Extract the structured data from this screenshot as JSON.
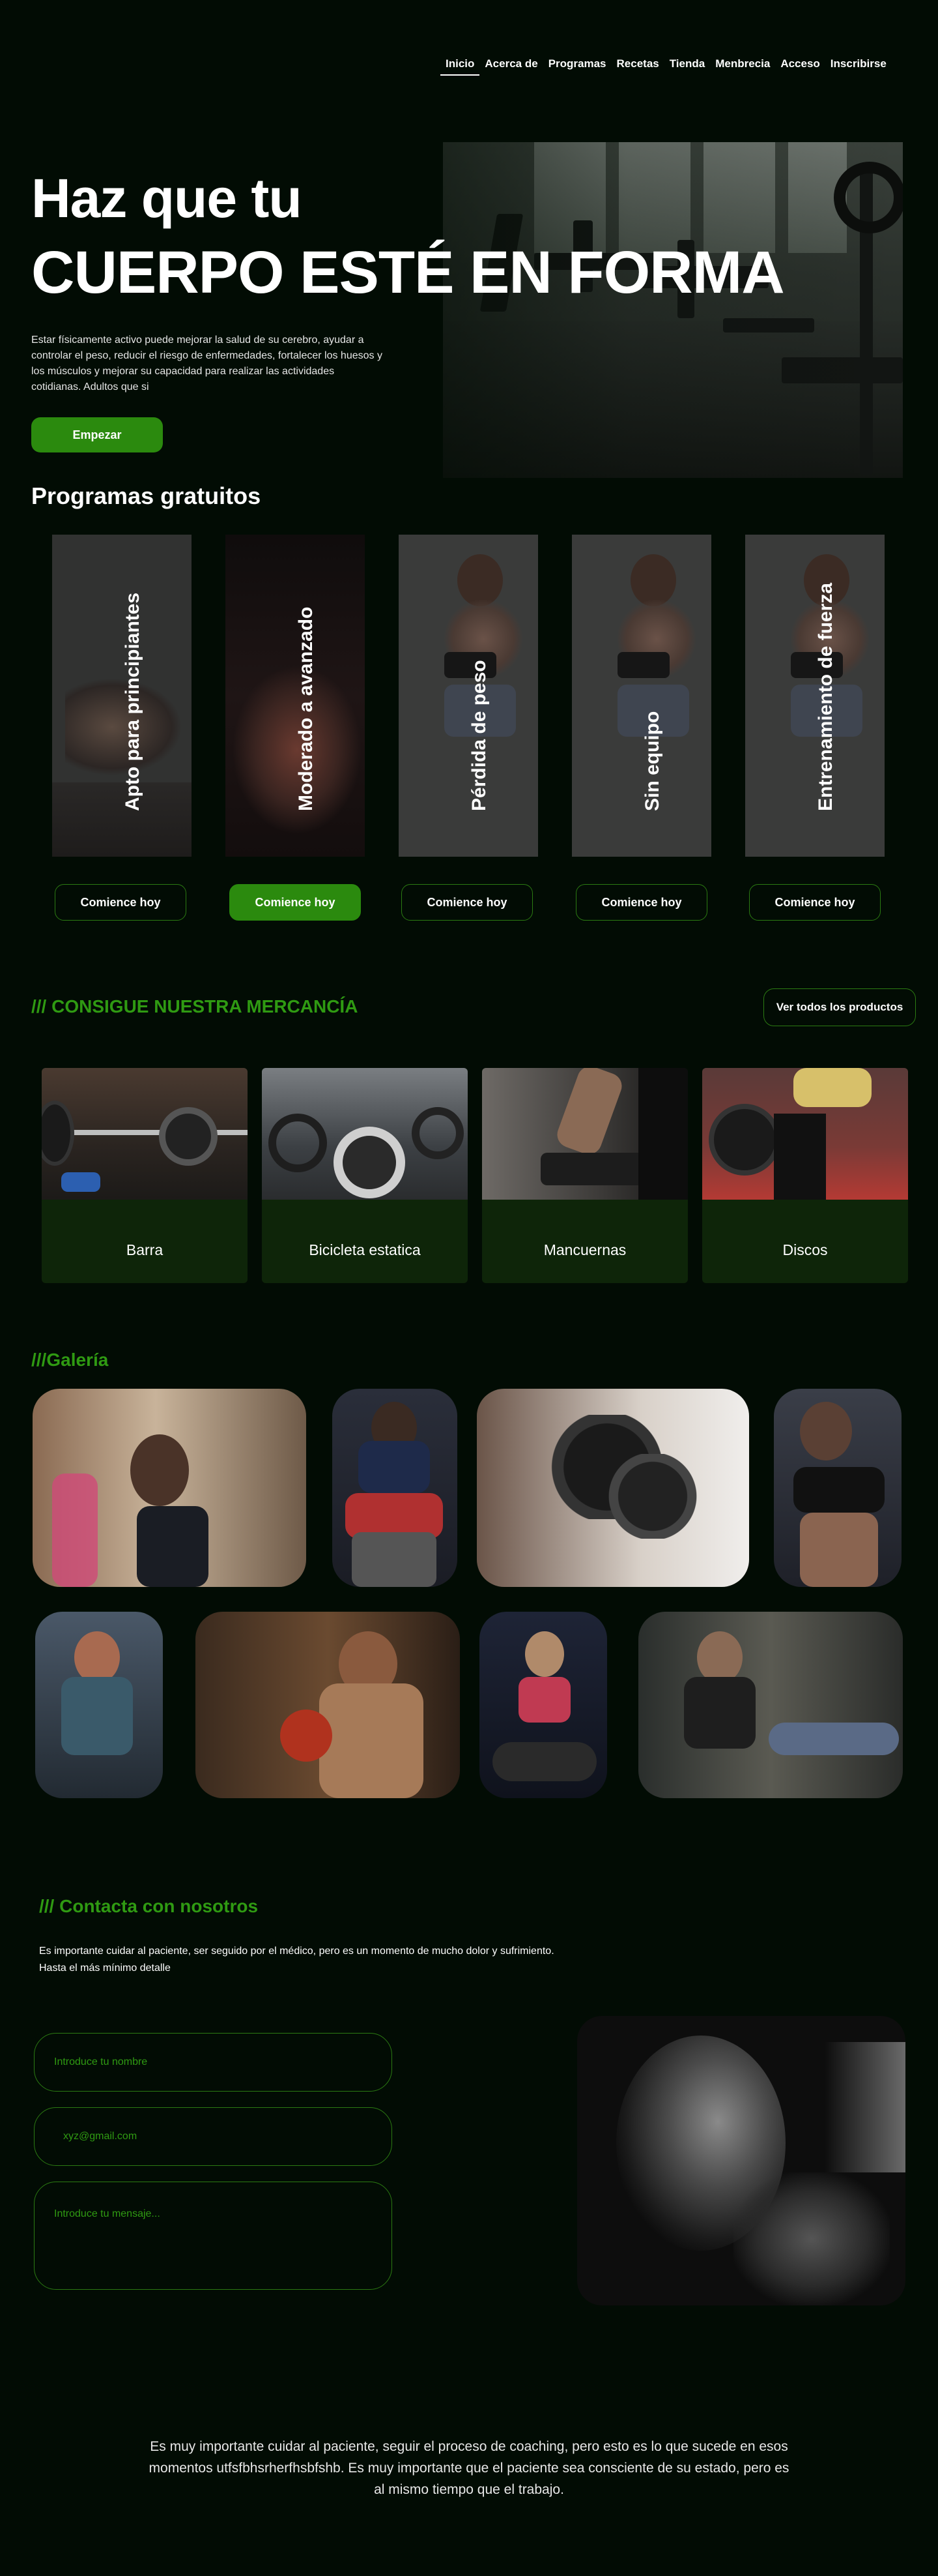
{
  "nav": {
    "items": [
      {
        "label": "Inicio",
        "active": true
      },
      {
        "label": "Acerca de",
        "active": false
      },
      {
        "label": "Programas",
        "active": false
      },
      {
        "label": "Recetas",
        "active": false
      },
      {
        "label": "Tienda",
        "active": false
      },
      {
        "label": "Menbrecia",
        "active": false
      },
      {
        "label": "Acceso",
        "active": false
      },
      {
        "label": "Inscribirse",
        "active": false
      }
    ]
  },
  "hero": {
    "title_line1": "Haz que tu",
    "title_line2": "CUERPO ESTÉ EN FORMA",
    "description": "Estar físicamente activo puede mejorar la salud de su cerebro, ayudar a controlar el peso, reducir el riesgo de enfermedades, fortalecer los huesos y los músculos y mejorar su capacidad para realizar las actividades cotidianas. Adultos que si",
    "cta_label": "Empezar"
  },
  "programs": {
    "title": "Programas gratuitos",
    "cards": [
      {
        "label": "Apto para principiantes",
        "button": "Comience hoy",
        "active": false
      },
      {
        "label": "Moderado a avanzado",
        "button": "Comience hoy",
        "active": true
      },
      {
        "label": "Pérdida de peso",
        "button": "Comience hoy",
        "active": false
      },
      {
        "label": "Sin equipo",
        "button": "Comience hoy",
        "active": false
      },
      {
        "label": "Entrenamiento de fuerza",
        "button": "Comience hoy",
        "active": false
      }
    ]
  },
  "merch": {
    "title": "/// CONSIGUE NUESTRA MERCANCÍA",
    "view_all": "Ver todos los productos",
    "items": [
      {
        "label": "Barra"
      },
      {
        "label": "Bicicleta estatica"
      },
      {
        "label": "Mancuernas"
      },
      {
        "label": "Discos"
      }
    ]
  },
  "gallery": {
    "title": "///Galería"
  },
  "contact": {
    "title": "/// Contacta con nosotros",
    "text_line1": "Es importante cuidar al paciente, ser seguido por el médico, pero es un momento de mucho dolor y sufrimiento.",
    "text_line2": "Hasta el más mínimo detalle",
    "name_placeholder": "Introduce tu nombre",
    "email_placeholder": "xyz@gmail.com",
    "message_placeholder": "Introduce tu mensaje..."
  },
  "footer": {
    "text": "Es muy importante cuidar al paciente, seguir el proceso de coaching, pero esto es lo que sucede en esos momentos utfsfbhsrherfhsbfshb.  Es muy importante que el paciente sea consciente de su estado, pero es al mismo tiempo que el trabajo."
  },
  "colors": {
    "background": "#020c04",
    "accent_green": "#2b8a0e",
    "title_green": "#2f9a12",
    "card_green": "#0e2509"
  }
}
